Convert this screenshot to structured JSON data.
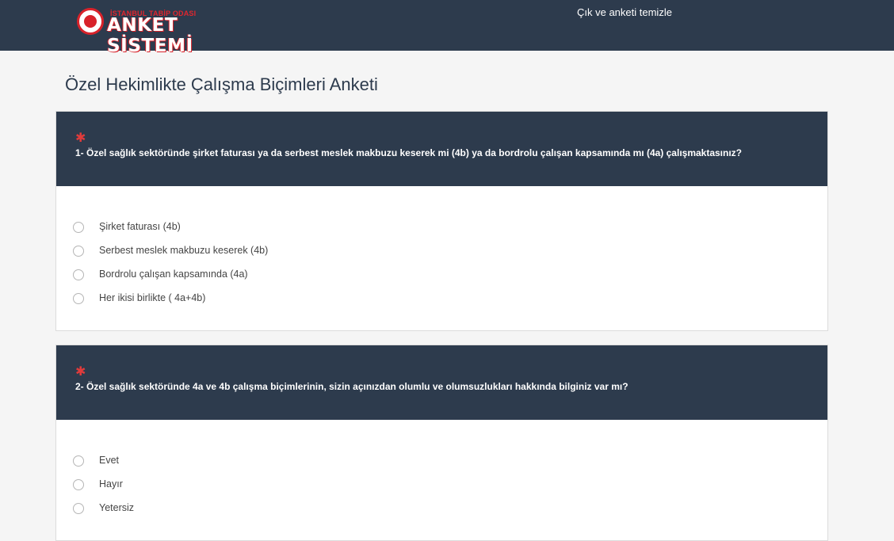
{
  "header": {
    "logo_small_text": "İSTANBUL TABİP ODASI",
    "logo_title": "ANKET SİSTEMİ",
    "logout_label": "Çık ve anketi temizle"
  },
  "page": {
    "title": "Özel Hekimlikte Çalışma Biçimleri Anketi"
  },
  "questions": [
    {
      "required_mark": "✱",
      "text": "1- Özel sağlık sektöründe şirket faturası ya da serbest meslek makbuzu keserek mi (4b) ya da bordrolu çalışan kapsamında mı (4a) çalışmaktasınız?",
      "options": [
        "Şirket faturası (4b)",
        "Serbest meslek makbuzu keserek (4b)",
        "Bordrolu çalışan kapsamında (4a)",
        "Her ikisi birlikte ( 4a+4b)"
      ]
    },
    {
      "required_mark": "✱",
      "text": "2- Özel sağlık sektöründe 4a ve 4b çalışma biçimlerinin, sizin açınızdan olumlu ve olumsuzlukları hakkında bilginiz var mı?",
      "options": [
        "Evet",
        "Hayır",
        "Yetersiz"
      ]
    }
  ]
}
